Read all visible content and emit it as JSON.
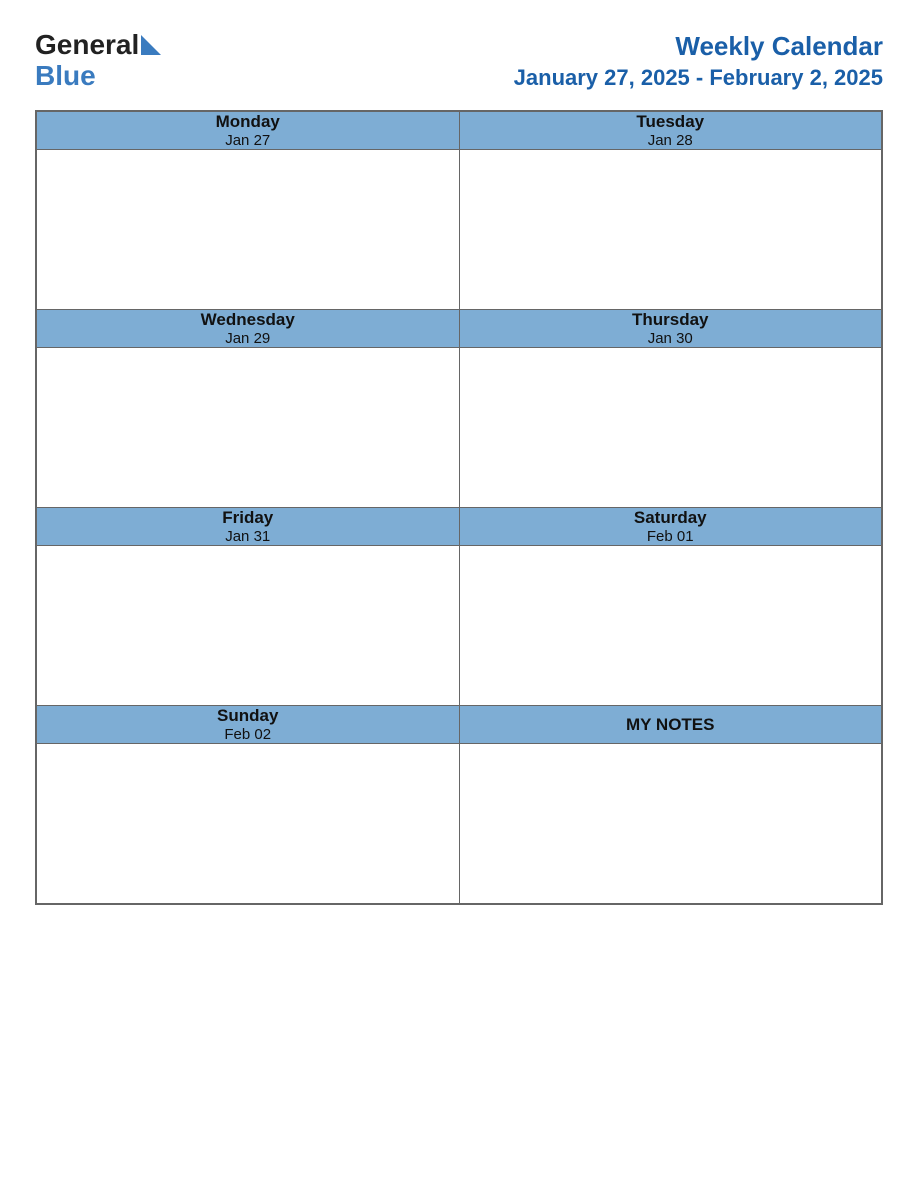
{
  "logo": {
    "text_part1": "General",
    "text_part2": "Blue"
  },
  "header": {
    "title": "Weekly Calendar",
    "subtitle": "January 27, 2025 - February 2, 2025"
  },
  "days": [
    {
      "name": "Monday",
      "date": "Jan 27"
    },
    {
      "name": "Tuesday",
      "date": "Jan 28"
    },
    {
      "name": "Wednesday",
      "date": "Jan 29"
    },
    {
      "name": "Thursday",
      "date": "Jan 30"
    },
    {
      "name": "Friday",
      "date": "Jan 31"
    },
    {
      "name": "Saturday",
      "date": "Feb 01"
    },
    {
      "name": "Sunday",
      "date": "Feb 02"
    }
  ],
  "notes": {
    "label": "MY NOTES"
  }
}
